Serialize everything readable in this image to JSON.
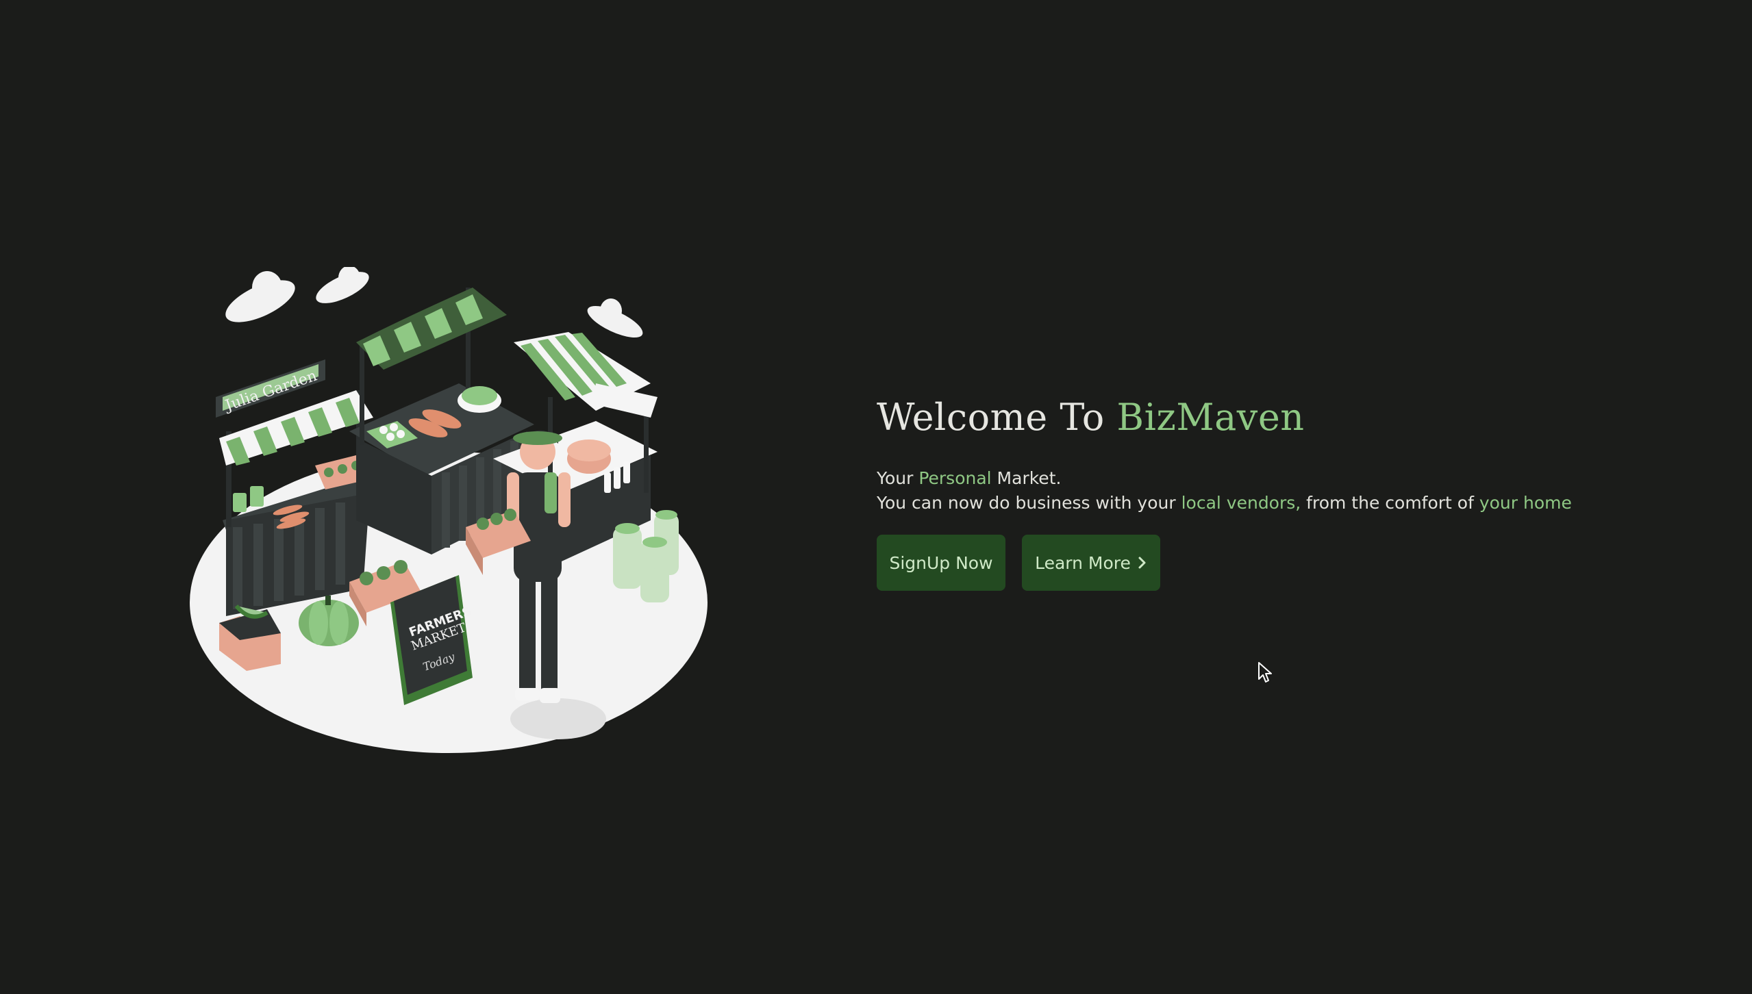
{
  "hero": {
    "title_prefix": "Welcome To ",
    "title_brand": "BizMaven",
    "line1_prefix": "Your ",
    "line1_accent": "Personal",
    "line1_suffix": " Market.",
    "line2_a": "You can now do business with your ",
    "line2_accent1": "local vendors,",
    "line2_b": " from the comfort of ",
    "line2_accent2": "your home"
  },
  "buttons": {
    "signup": "SignUp Now",
    "learn": "Learn More"
  },
  "illustration": {
    "stall_sign": "Julia Garden",
    "board_line1": "FARMERS",
    "board_line2": "MARKET",
    "board_line3": "Today"
  },
  "colors": {
    "background": "#1b1c1a",
    "accent": "#8fc884",
    "button": "#234a21"
  },
  "icons": {
    "learn_more": "chevron-right-icon",
    "cursor": "mouse-pointer-icon"
  }
}
